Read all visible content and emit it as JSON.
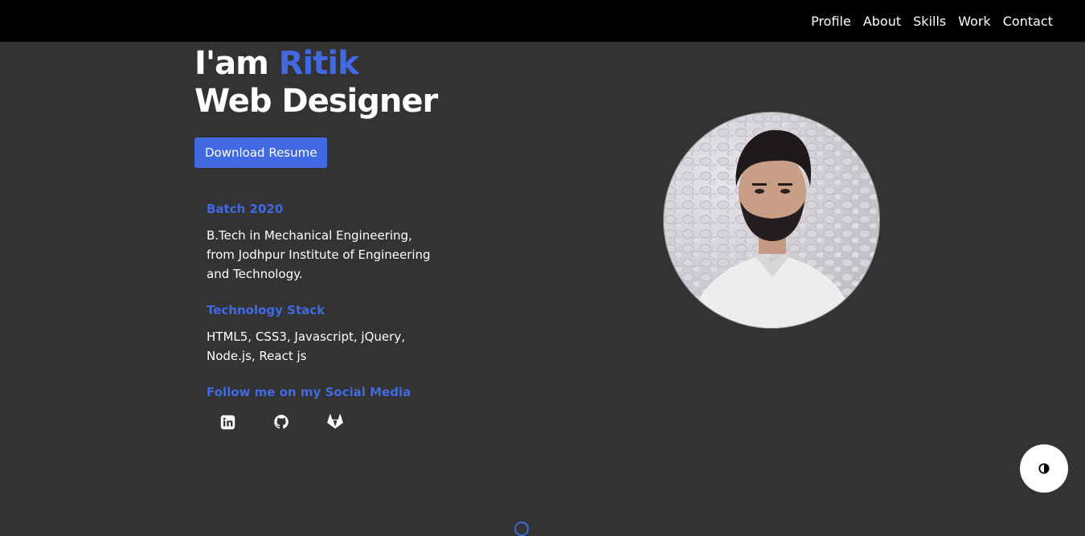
{
  "nav": {
    "items": [
      {
        "label": "Profile"
      },
      {
        "label": "About"
      },
      {
        "label": "Skills"
      },
      {
        "label": "Work"
      },
      {
        "label": "Contact"
      }
    ]
  },
  "hero": {
    "greeting": "I'am ",
    "name": "Ritik",
    "role": "Web Designer",
    "resume_button": "Download Resume"
  },
  "info": {
    "batch_heading": "Batch 2020",
    "batch_text": "B.Tech in Mechanical Engineering,\nfrom Jodhpur Institute of Engineering\nand Technology.",
    "tech_heading": "Technology Stack",
    "tech_text": "HTML5, CSS3, Javascript, jQuery,\nNode.js, React js",
    "social_heading": "Follow me on my Social Media",
    "social_icons": [
      "linkedin-icon",
      "github-icon",
      "gitlab-icon"
    ]
  },
  "theme_toggle": {
    "icon": "contrast-icon"
  },
  "colors": {
    "accent": "#4169e1",
    "background": "#333333",
    "navbar": "#000000"
  }
}
